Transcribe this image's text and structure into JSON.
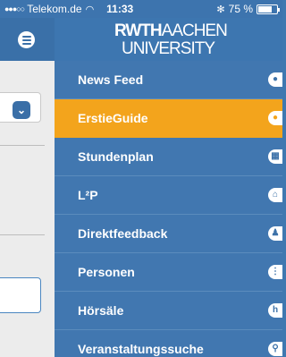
{
  "status_bar": {
    "signal": "●●●○○",
    "carrier": "Telekom.de",
    "wifi": "◠",
    "time": "11:33",
    "bluetooth": "✻",
    "battery_text": "75 %",
    "battery_level": 0.75
  },
  "header": {
    "logo_rwth": "RWTH",
    "logo_aachen": "AACHEN",
    "logo_university": "UNIVERSITY"
  },
  "menu": {
    "items": [
      {
        "label": "News Feed",
        "icon": "speech-bubble-icon",
        "glyph": "●",
        "active": false
      },
      {
        "label": "ErstieGuide",
        "icon": "speech-bubble-icon",
        "glyph": "●",
        "active": true
      },
      {
        "label": "Stundenplan",
        "icon": "calendar-icon",
        "glyph": "▦",
        "active": false
      },
      {
        "label": "L²P",
        "icon": "bridge-icon",
        "glyph": "⌂",
        "active": false
      },
      {
        "label": "Direktfeedback",
        "icon": "person-icon",
        "glyph": "♟",
        "active": false
      },
      {
        "label": "Personen",
        "icon": "contact-icon",
        "glyph": "⋮",
        "active": false
      },
      {
        "label": "Hörsäle",
        "icon": "lecture-hall-icon",
        "glyph": "h",
        "active": false
      },
      {
        "label": "Veranstaltungssuche",
        "icon": "search-icon",
        "glyph": "⚲",
        "active": false
      }
    ]
  },
  "colors": {
    "primary_blue": "#4177b0",
    "active_orange": "#f3a41c"
  }
}
